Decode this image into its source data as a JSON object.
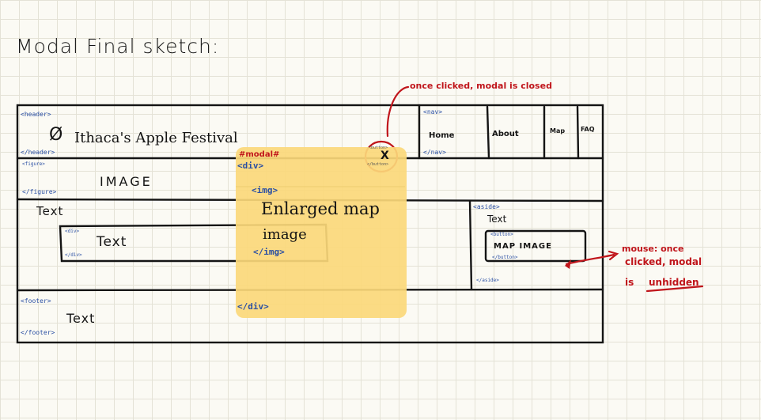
{
  "title": "Modal Final sketch:",
  "header": {
    "tag_open": "<header>",
    "tag_close": "</header>",
    "logo_glyph": "Ø",
    "site_title": "Ithaca's Apple Festival"
  },
  "nav": {
    "tag_open": "<nav>",
    "tag_close": "</nav>",
    "items": [
      "Home",
      "About",
      "Map",
      "FAQ"
    ]
  },
  "figure": {
    "tag_open": "<figure>",
    "tag_close": "</figure>",
    "label": "IMAGE"
  },
  "main": {
    "text1": "Text",
    "div_open": "<div>",
    "div_close": "</div>",
    "text2": "Text"
  },
  "aside": {
    "tag_open": "<aside>",
    "tag_close": "</aside>",
    "text": "Text",
    "button_open": "<button>",
    "button_close": "</button>",
    "map_button": "MAP IMAGE"
  },
  "footer": {
    "tag_open": "<footer>",
    "tag_close": "</footer>",
    "text": "Text"
  },
  "modal": {
    "label": "#modal#",
    "div_open": "<div>",
    "div_close": "</div>",
    "img_open": "<img>",
    "img_close": "</img>",
    "img_text_1": "Enlarged map",
    "img_text_2": "image",
    "close_btn_open": "<button>",
    "close_btn_close": "</button>",
    "close_glyph": "X"
  },
  "annotations": {
    "close_note": "once clicked, modal is closed",
    "open_note_1": "mouse: once",
    "open_note_2": "clicked, modal",
    "open_note_3": "is",
    "open_note_4": "unhidden"
  },
  "colors": {
    "ink": "#141414",
    "tag_blue": "#2a4fa3",
    "annotation_red": "#c0151b",
    "modal_yellow": "#fbd879"
  }
}
